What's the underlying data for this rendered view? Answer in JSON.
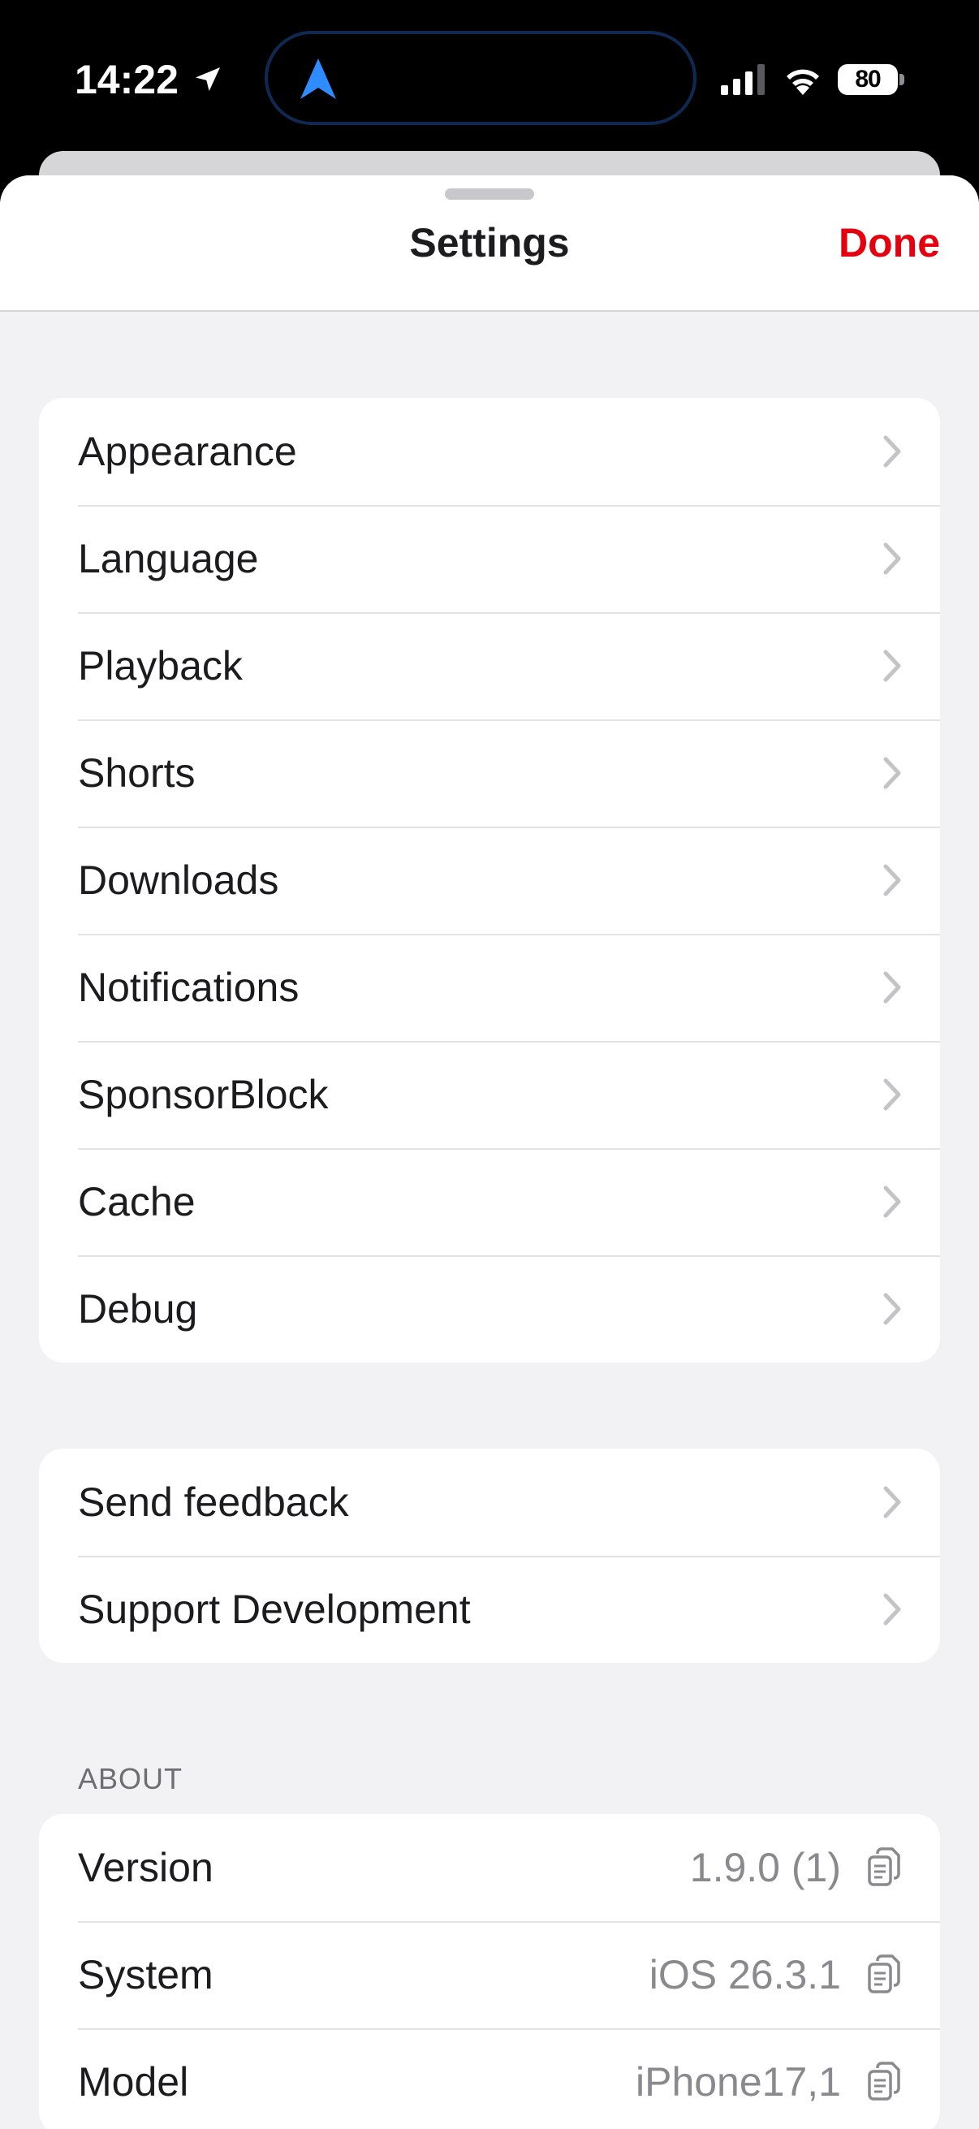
{
  "status_bar": {
    "time": "14:22",
    "battery": "80"
  },
  "header": {
    "title": "Settings",
    "done_label": "Done"
  },
  "main_group": [
    {
      "label": "Appearance"
    },
    {
      "label": "Language"
    },
    {
      "label": "Playback"
    },
    {
      "label": "Shorts"
    },
    {
      "label": "Downloads"
    },
    {
      "label": "Notifications"
    },
    {
      "label": "SponsorBlock"
    },
    {
      "label": "Cache"
    },
    {
      "label": "Debug"
    }
  ],
  "support_group": [
    {
      "label": "Send feedback"
    },
    {
      "label": "Support Development"
    }
  ],
  "about": {
    "header": "ABOUT",
    "rows": [
      {
        "label": "Version",
        "value": "1.9.0 (1)"
      },
      {
        "label": "System",
        "value": "iOS 26.3.1"
      },
      {
        "label": "Model",
        "value": "iPhone17,1"
      }
    ]
  },
  "colors": {
    "accent": "#e5000f",
    "island_arrow": "#2f8cff",
    "chevron": "#c4c4c7",
    "secondary_text": "#8a8a8e"
  },
  "icons": {
    "location": "location-arrow-icon",
    "island": "navigation-arrow-icon",
    "signal": "cellular-signal-icon",
    "wifi": "wifi-icon",
    "battery": "battery-icon",
    "chevron": "chevron-right-icon",
    "copy": "copy-icon"
  }
}
